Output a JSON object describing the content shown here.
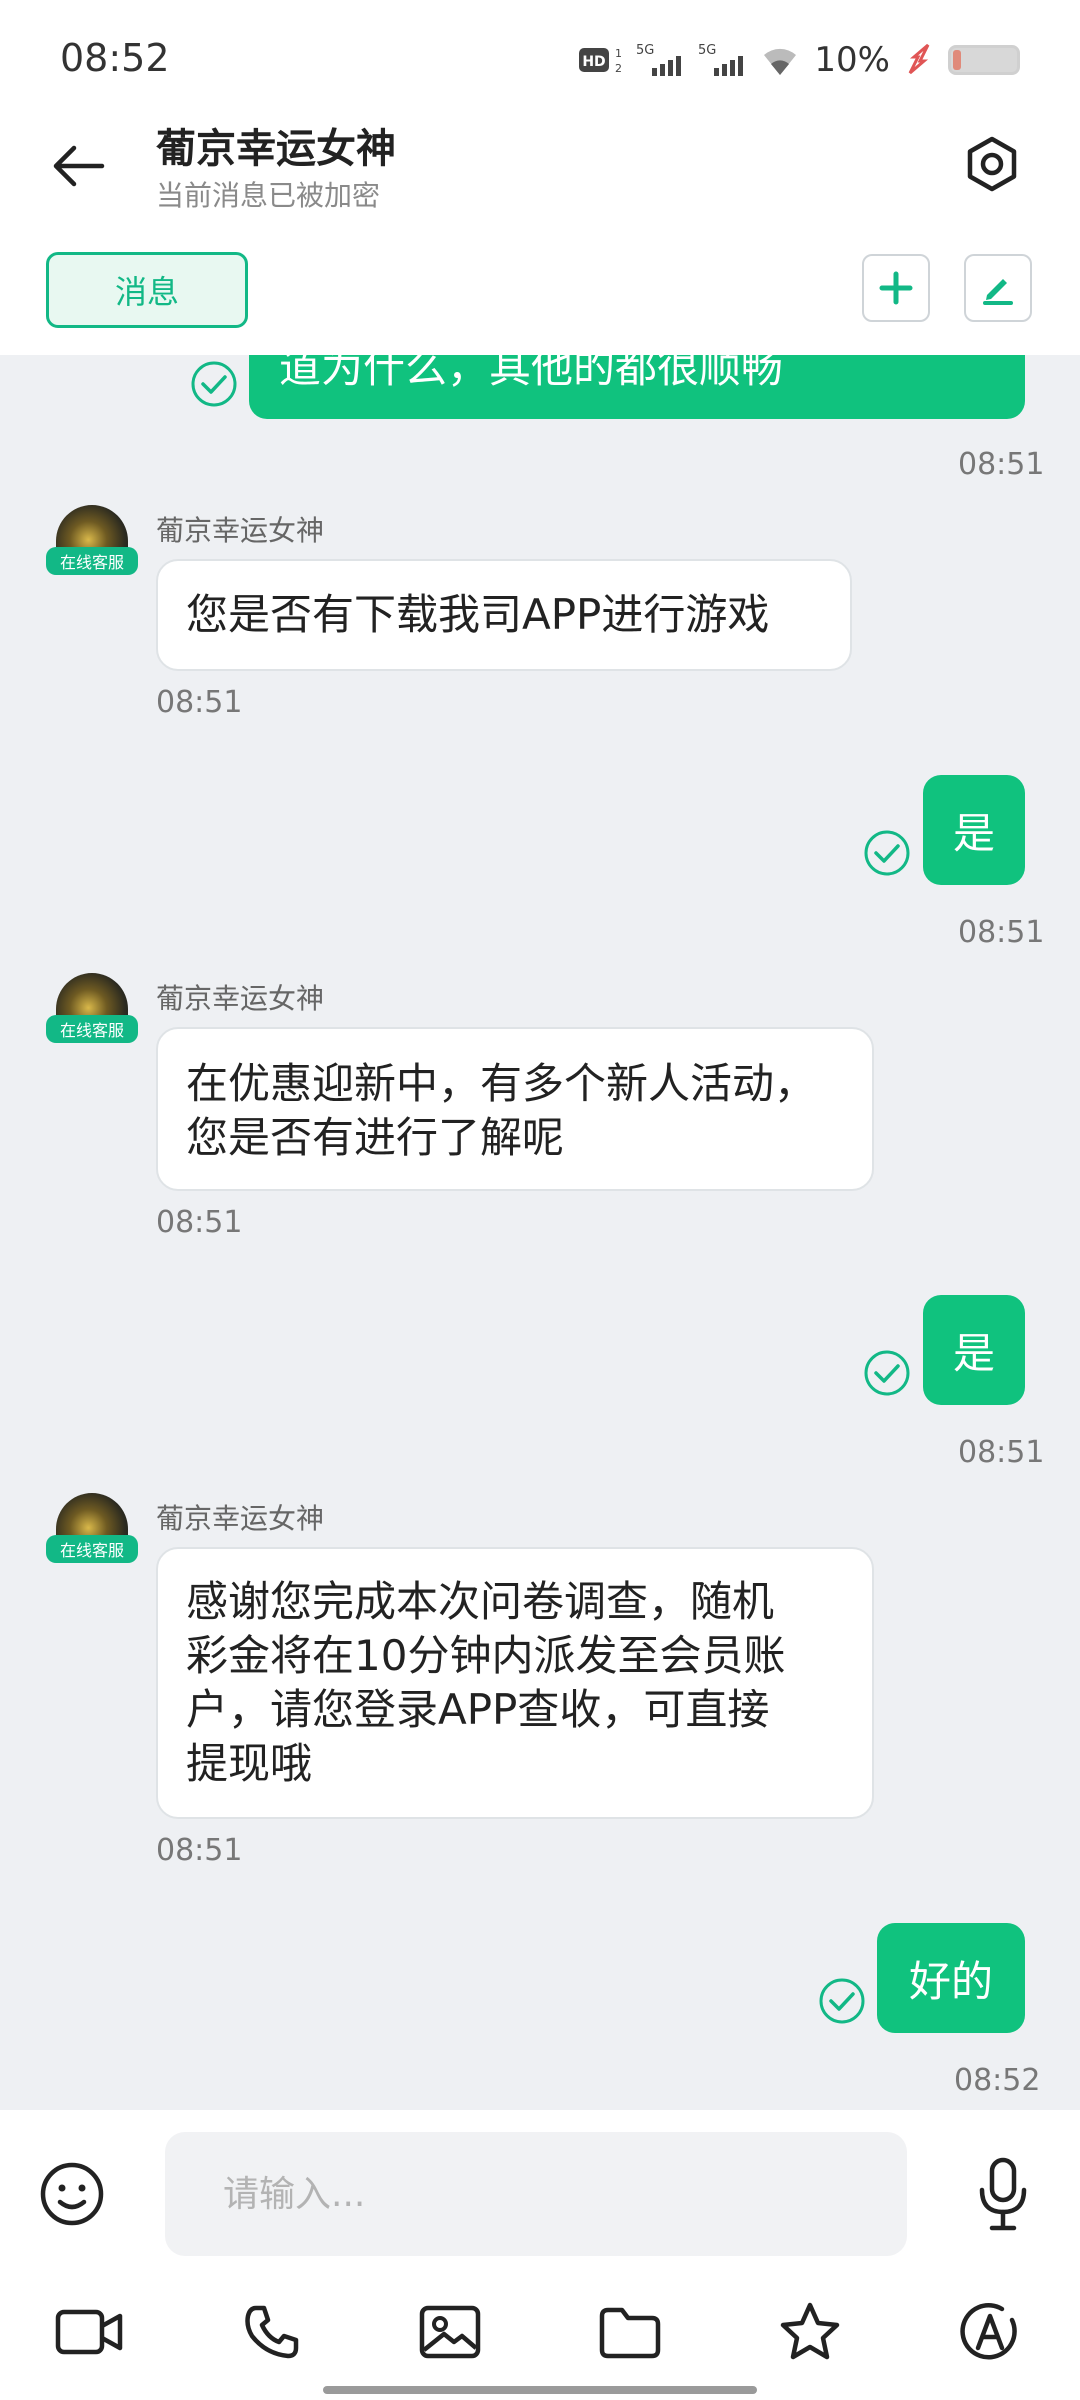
{
  "status_bar": {
    "time": "08:52",
    "hd_label": "HD",
    "signal1": "5G",
    "signal2": "5G",
    "battery_pct": "10%"
  },
  "header": {
    "title": "葡京幸运女神",
    "subtitle": "当前消息已被加密"
  },
  "tabs": {
    "messages_label": "消息"
  },
  "messages": [
    {
      "direction": "out",
      "text": "道为什么，其他的都很顺畅",
      "time": "08:51"
    },
    {
      "direction": "in",
      "sender": "葡京幸运女神",
      "badge": "在线客服",
      "text": "您是否有下载我司APP进行游戏",
      "time": "08:51"
    },
    {
      "direction": "out",
      "text": "是",
      "time": "08:51"
    },
    {
      "direction": "in",
      "sender": "葡京幸运女神",
      "badge": "在线客服",
      "lines": [
        "在优惠迎新中，有多个新人活动，",
        "您是否有进行了解呢"
      ],
      "time": "08:51"
    },
    {
      "direction": "out",
      "text": "是",
      "time": "08:51"
    },
    {
      "direction": "in",
      "sender": "葡京幸运女神",
      "badge": "在线客服",
      "lines": [
        "感谢您完成本次问卷调查，随机",
        "彩金将在10分钟内派发至会员账",
        "户，请您登录APP查收，可直接",
        "提现哦"
      ],
      "time": "08:51"
    },
    {
      "direction": "out",
      "text": "好的",
      "time": "08:52"
    }
  ],
  "input": {
    "placeholder": "请输入..."
  },
  "colors": {
    "accent": "#10c27e",
    "chat_bg": "#eef0f3"
  },
  "icons": {
    "back": "arrow-left-icon",
    "settings": "hexagon-gear-icon",
    "add": "plus-icon",
    "edit": "pen-icon",
    "emoji": "smile-icon",
    "mic": "microphone-icon",
    "video": "video-camera-icon",
    "phone": "phone-icon",
    "image": "image-icon",
    "folder": "folder-icon",
    "star": "star-icon",
    "font": "font-a-icon"
  }
}
